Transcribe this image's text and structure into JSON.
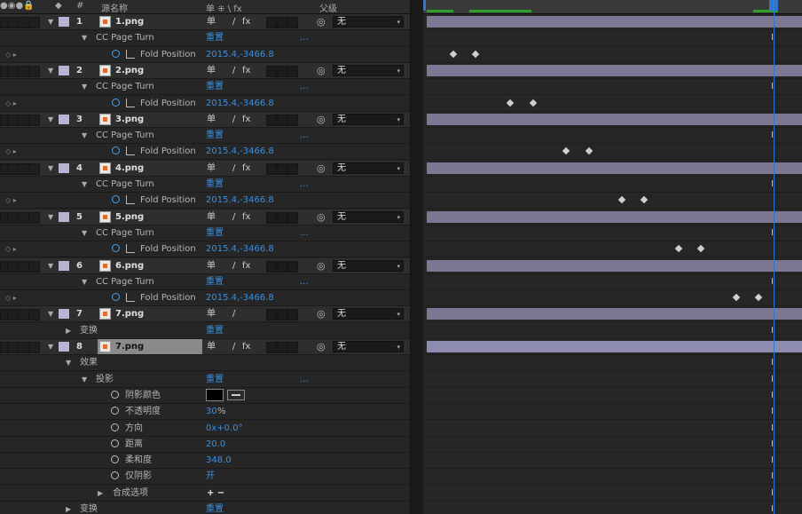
{
  "header": {
    "col_hash": "#",
    "col_source_name": "源名称",
    "col_switches": "单 ⁜ \\ fx",
    "col_parent": "父级"
  },
  "layers": [
    {
      "num": "1",
      "name": "1.png",
      "effect": "CC Page Turn",
      "reset": "重置",
      "dots": "...",
      "prop": "Fold Position",
      "value": "2015.4,-3466.8",
      "parent": "无",
      "kf": [
        0.073,
        0.132
      ]
    },
    {
      "num": "2",
      "name": "2.png",
      "effect": "CC Page Turn",
      "reset": "重置",
      "dots": "...",
      "prop": "Fold Position",
      "value": "2015.4,-3466.8",
      "parent": "无",
      "kf": [
        0.223,
        0.283
      ]
    },
    {
      "num": "3",
      "name": "3.png",
      "effect": "CC Page Turn",
      "reset": "重置",
      "dots": "...",
      "prop": "Fold Position",
      "value": "2015.4,-3466.8",
      "parent": "无",
      "kf": [
        0.371,
        0.43
      ]
    },
    {
      "num": "4",
      "name": "4.png",
      "effect": "CC Page Turn",
      "reset": "重置",
      "dots": "...",
      "prop": "Fold Position",
      "value": "2015.4,-3466.8",
      "parent": "无",
      "kf": [
        0.518,
        0.577
      ]
    },
    {
      "num": "5",
      "name": "5.png",
      "effect": "CC Page Turn",
      "reset": "重置",
      "dots": "...",
      "prop": "Fold Position",
      "value": "2015.4,-3466.8",
      "parent": "无",
      "kf": [
        0.667,
        0.726
      ]
    },
    {
      "num": "6",
      "name": "6.png",
      "effect": "CC Page Turn",
      "reset": "重置",
      "dots": "...",
      "prop": "Fold Position",
      "value": "2015.4,-3466.8",
      "parent": "无",
      "kf": [
        0.82,
        0.878
      ]
    }
  ],
  "layer7": {
    "num": "7",
    "name": "7.png",
    "sub": "变换",
    "reset": "重置",
    "parent": "无"
  },
  "layer8": {
    "num": "8",
    "name": "7.png",
    "parent": "无",
    "effects_label": "效果",
    "drop_shadow": "投影",
    "reset": "重置",
    "dots": "...",
    "props": [
      {
        "label": "阴影颜色",
        "value": ""
      },
      {
        "label": "不透明度",
        "value": "30",
        "suffix": "%"
      },
      {
        "label": "方向",
        "value": "0x+0.0°",
        "suffix": ""
      },
      {
        "label": "距离",
        "value": "20.0",
        "suffix": ""
      },
      {
        "label": "柔和度",
        "value": "348.0",
        "suffix": ""
      },
      {
        "label": "仅阴影",
        "value": "开",
        "suffix": ""
      }
    ],
    "composite": "合成选项",
    "composite_ctrl": "+ −",
    "transform": "变换",
    "transform_reset": "重置"
  },
  "icons": {
    "sticky": "单",
    "pen": "/",
    "fx": "fx",
    "spiral": "◎",
    "dropdown": "▾"
  }
}
